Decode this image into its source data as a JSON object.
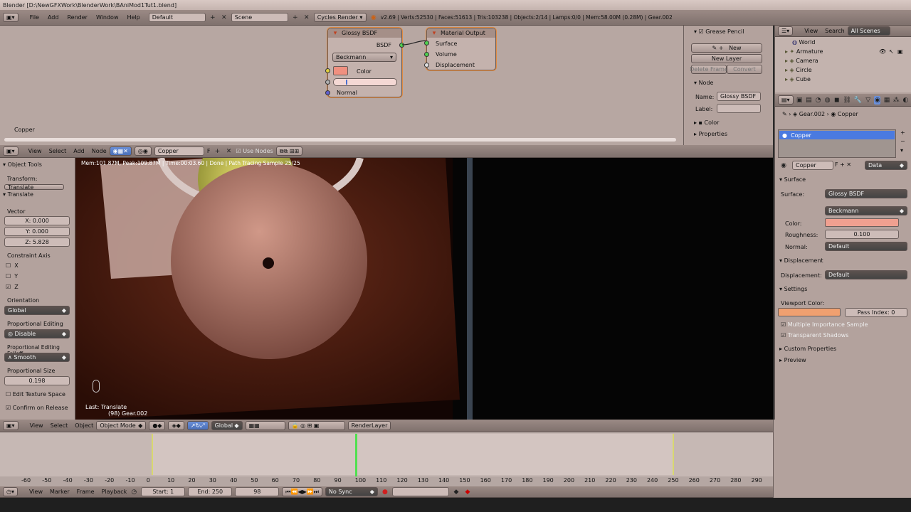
{
  "titlebar": {
    "title": "Blender  [D:\\NewGFXWork\\BlenderWork\\BAniMod1Tut1.blend]"
  },
  "infobar": {
    "menus": [
      "File",
      "Add",
      "Render",
      "Window",
      "Help"
    ],
    "screen": "Default",
    "scene": "Scene",
    "engine": "Cycles Render",
    "stats": "v2.69 | Verts:52530 | Faces:51613 | Tris:103238 | Objects:2/14 | Lamps:0/0 | Mem:58.00M (0.28M) | Gear.002"
  },
  "node_editor": {
    "material_label": "Copper",
    "glossy_node": {
      "title": "Glossy BSDF",
      "output": "BSDF",
      "distribution": "Beckmann",
      "color_label": "Color",
      "normal_label": "Normal"
    },
    "output_node": {
      "title": "Material Output",
      "inputs": [
        "Surface",
        "Volume",
        "Displacement"
      ]
    },
    "header": {
      "menus": [
        "View",
        "Select",
        "Add",
        "Node"
      ],
      "material": "Copper",
      "fake": "F",
      "use_nodes": "Use Nodes"
    },
    "colors": {
      "node_bg": "#c4b2ad",
      "select": "#e08a40",
      "color_swatch": "#f09080"
    }
  },
  "node_sidebar": {
    "grease_pencil": "Grease Pencil",
    "new": "New",
    "new_layer": "New Layer",
    "delete_frame": "Delete Frame",
    "convert": "Convert",
    "node_section": "Node",
    "name_label": "Name:",
    "name_value": "Glossy BSDF",
    "label_label": "Label:",
    "color_section": "Color",
    "properties_section": "Properties"
  },
  "outliner": {
    "menus": [
      "View",
      "Search"
    ],
    "scope": "All Scenes",
    "items": [
      "World",
      "Armature",
      "Camera",
      "Circle",
      "Cube"
    ]
  },
  "properties": {
    "breadcrumb": [
      "Gear.002",
      "Copper"
    ],
    "slot": "Copper",
    "material_name": "Copper",
    "data_link": "Data",
    "surface_section": "Surface",
    "surface_label": "Surface:",
    "surface_value": "Glossy BSDF",
    "distribution": "Beckmann",
    "color_label": "Color:",
    "roughness_label": "Roughness:",
    "roughness_value": "0.100",
    "normal_label": "Normal:",
    "normal_value": "Default",
    "displacement_section": "Displacement",
    "displacement_label": "Displacement:",
    "displacement_value": "Default",
    "settings_section": "Settings",
    "viewport_color_label": "Viewport Color:",
    "pass_index": "Pass Index: 0",
    "mis": "Multiple Importance Sample",
    "transparent_shadows": "Transparent Shadows",
    "custom_props": "Custom Properties",
    "preview": "Preview",
    "colors": {
      "surface_color": "#f0a090",
      "viewport_color": "#f0a070"
    }
  },
  "tool_shelf": {
    "object_tools": "Object Tools",
    "transform": "Transform:",
    "translate_btn": "Translate",
    "translate_section": "Translate",
    "vector": "Vector",
    "x": "X: 0.000",
    "y": "Y: 0.000",
    "z": "Z: 5.828",
    "constraint_axis": "Constraint Axis",
    "axis_x": "X",
    "axis_y": "Y",
    "axis_z": "Z",
    "orientation": "Orientation",
    "orientation_value": "Global",
    "prop_editing": "Proportional Editing",
    "prop_editing_value": "Disable",
    "falloff": "Proportional Editing Falloff",
    "falloff_value": "Smooth",
    "prop_size": "Proportional Size",
    "prop_size_value": "0.198",
    "edit_texture_space": "Edit Texture Space",
    "confirm_on_release": "Confirm on Release"
  },
  "viewport": {
    "render_info": "Mem:101.87M, Peak:109.87M | Time:00:03.60 | Done | Path Tracing Sample 25/25",
    "last_op": "Last: Translate",
    "object_label": "(98) Gear.002",
    "header": {
      "menus": [
        "View",
        "Select",
        "Object"
      ],
      "mode": "Object Mode",
      "orientation": "Global",
      "layer": "RenderLayer"
    }
  },
  "timeline": {
    "ticks": [
      "-60",
      "-50",
      "-40",
      "-30",
      "-20",
      "-10",
      "0",
      "10",
      "20",
      "30",
      "40",
      "50",
      "60",
      "70",
      "80",
      "90",
      "100",
      "110",
      "120",
      "130",
      "140",
      "150",
      "160",
      "170",
      "180",
      "190",
      "200",
      "210",
      "220",
      "230",
      "240",
      "250",
      "260",
      "270",
      "280",
      "290"
    ],
    "menus": [
      "View",
      "Marker",
      "Frame",
      "Playback"
    ],
    "start": "Start: 1",
    "end": "End: 250",
    "current": "98",
    "sync": "No Sync"
  }
}
